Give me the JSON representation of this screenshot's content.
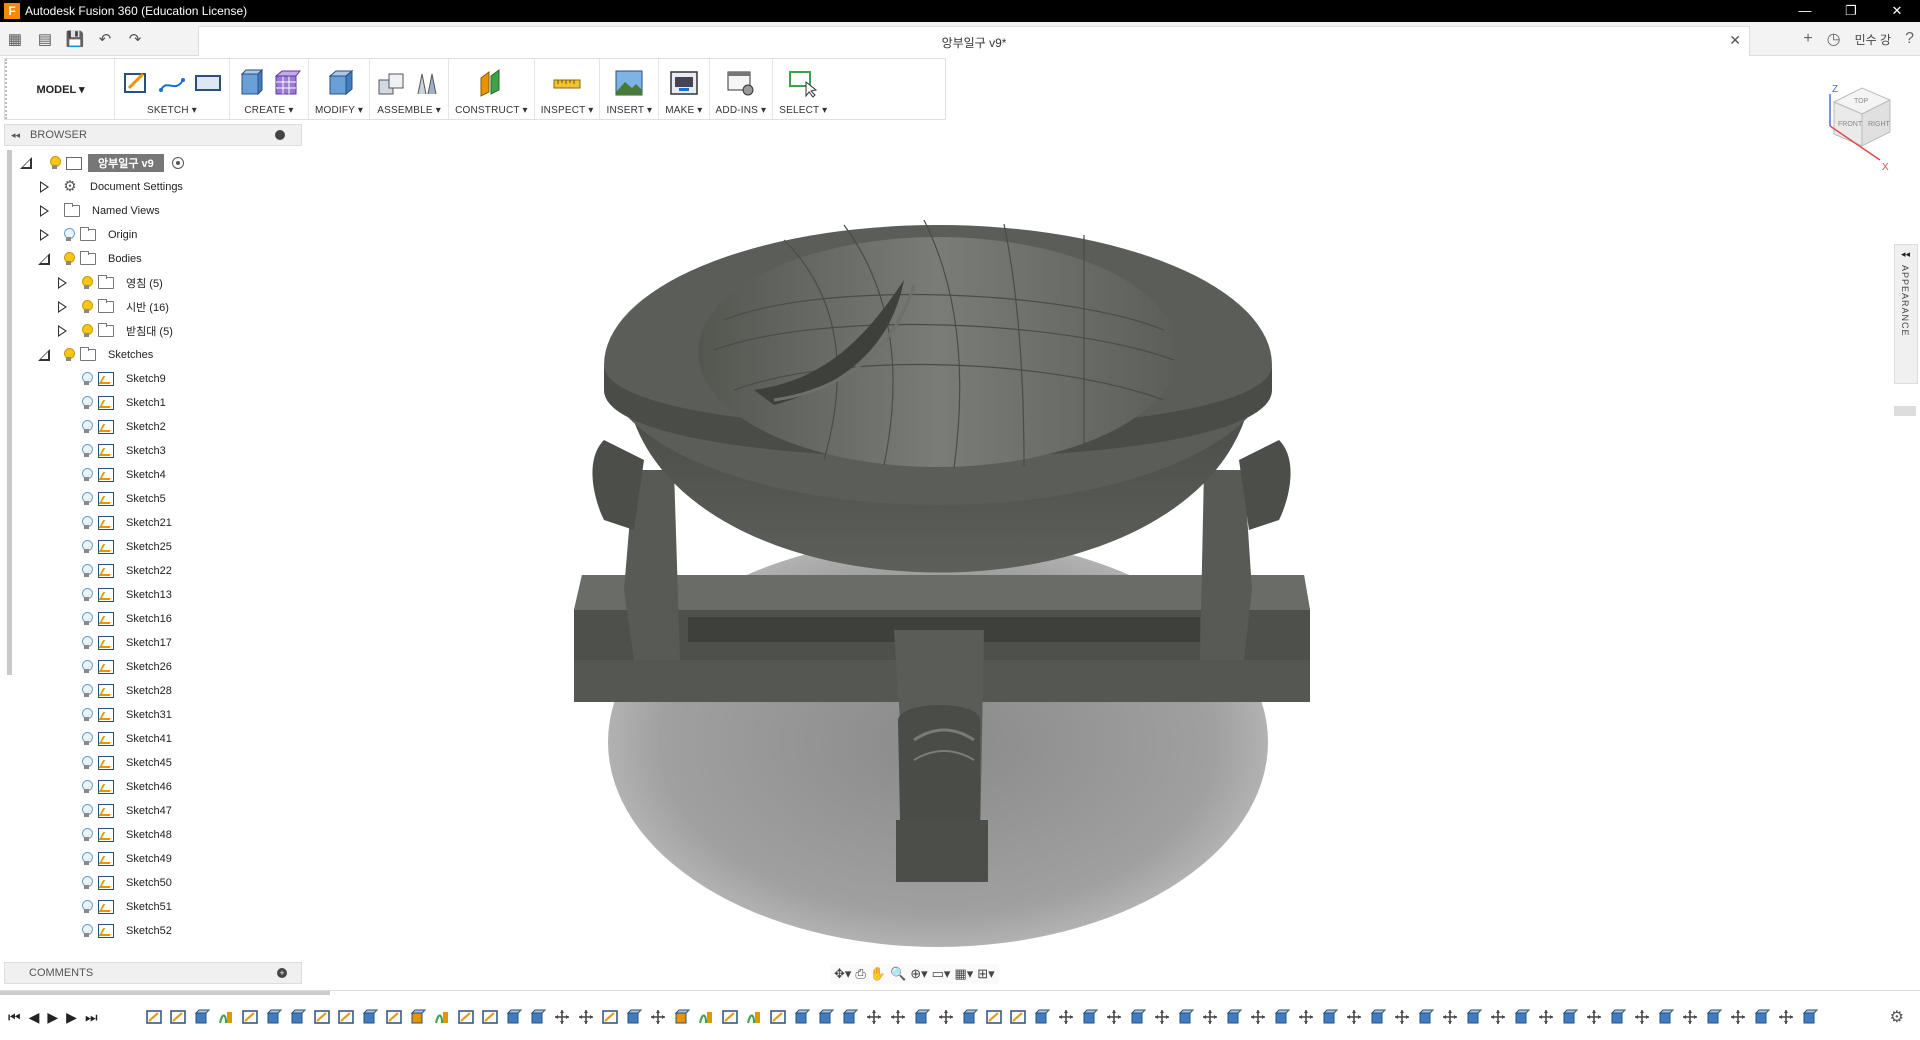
{
  "window": {
    "title": "Autodesk Fusion 360 (Education License)",
    "controls": [
      "—",
      "❐",
      "✕"
    ]
  },
  "appbar": {
    "doc_tab_title": "앙부일구 v9*",
    "doc_tab_close": "✕",
    "user_name": "민수 강",
    "help": "?"
  },
  "toolbar": {
    "mode": "MODEL ▾",
    "groups": [
      {
        "label": "SKETCH ▾"
      },
      {
        "label": "CREATE ▾"
      },
      {
        "label": "MODIFY ▾"
      },
      {
        "label": "ASSEMBLE ▾"
      },
      {
        "label": "CONSTRUCT ▾"
      },
      {
        "label": "INSPECT ▾"
      },
      {
        "label": "INSERT ▾"
      },
      {
        "label": "MAKE ▾"
      },
      {
        "label": "ADD-INS ▾"
      },
      {
        "label": "SELECT ▾"
      }
    ]
  },
  "browser": {
    "title": "BROWSER",
    "root": "앙부일구 v9",
    "items": [
      {
        "label": "Document Settings"
      },
      {
        "label": "Named Views"
      },
      {
        "label": "Origin"
      },
      {
        "label": "Bodies"
      },
      {
        "label": "영침 (5)"
      },
      {
        "label": "시반 (16)"
      },
      {
        "label": "받침대 (5)"
      },
      {
        "label": "Sketches"
      }
    ],
    "sketches": [
      "Sketch9",
      "Sketch1",
      "Sketch2",
      "Sketch3",
      "Sketch4",
      "Sketch5",
      "Sketch21",
      "Sketch25",
      "Sketch22",
      "Sketch13",
      "Sketch16",
      "Sketch17",
      "Sketch26",
      "Sketch28",
      "Sketch31",
      "Sketch41",
      "Sketch45",
      "Sketch46",
      "Sketch47",
      "Sketch48",
      "Sketch49",
      "Sketch50",
      "Sketch51",
      "Sketch52"
    ]
  },
  "comments": {
    "title": "COMMENTS"
  },
  "viewcube": {
    "top": "TOP",
    "front": "FRONT",
    "right": "RIGHT",
    "z": "Z",
    "x": "X"
  },
  "appearance_tab": "APPEARANCE",
  "timeline": {
    "controls": [
      "⏮",
      "◀",
      "▶",
      "▶",
      "⏭"
    ]
  },
  "colors": {
    "model": "#5b5d58",
    "shadow": "#8e8e8e",
    "accent_orange": "#f28b00"
  }
}
